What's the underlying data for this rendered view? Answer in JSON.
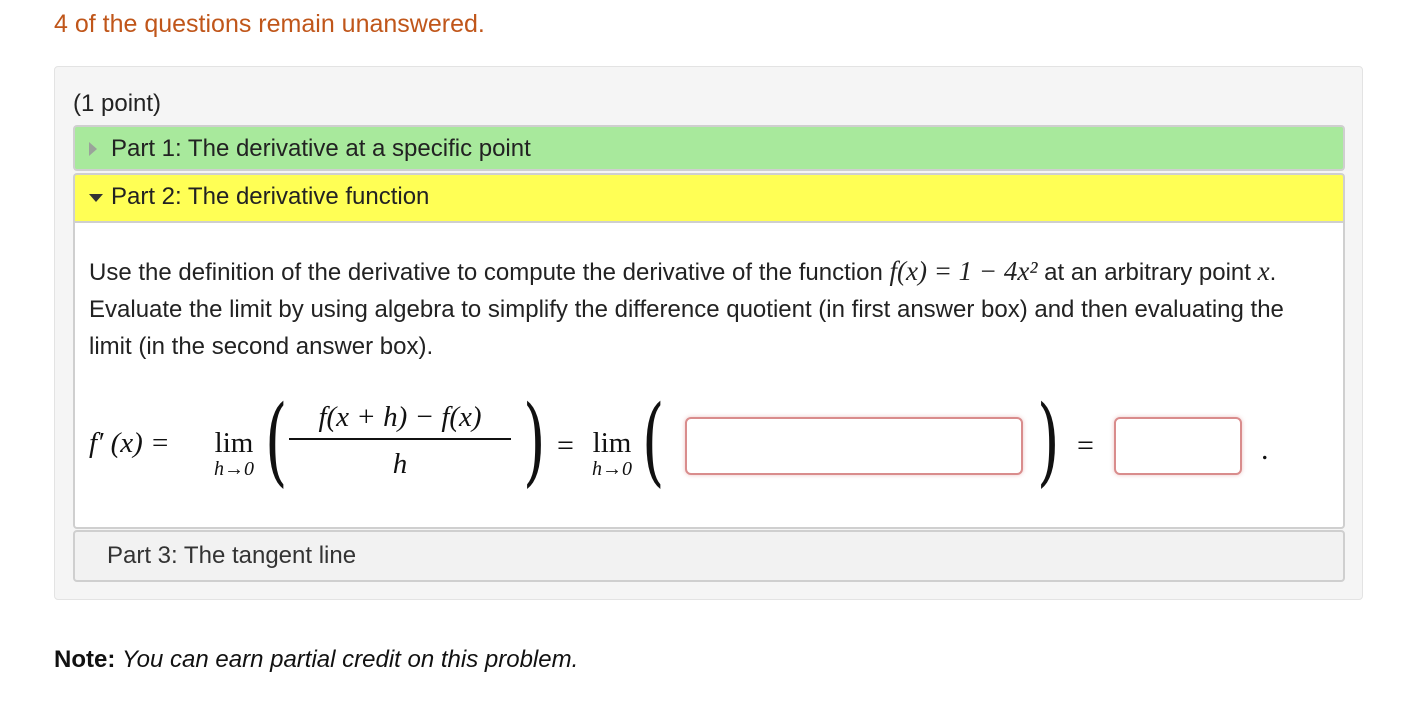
{
  "status": {
    "unanswered_text": "4 of the questions remain unanswered."
  },
  "problem": {
    "points_label": "(1 point)",
    "parts": [
      {
        "label": "Part 1: The derivative at a specific point",
        "state": "collapsed",
        "color": "#a8e99c"
      },
      {
        "label": "Part 2: The derivative function",
        "state": "expanded",
        "color": "#ffff55"
      },
      {
        "label": "Part 3: The tangent line",
        "state": "locked",
        "color": "#f2f2f2"
      }
    ],
    "question": {
      "text_1": "Use the definition of the derivative to compute the derivative of the function ",
      "function_expr": "f(x) = 1 − 4x²",
      "text_2": " at an arbitrary point ",
      "var": "x",
      "text_3": ". Evaluate the limit by using algebra to simplify the difference quotient (in first answer box) and then evaluating the limit (in the second answer box)."
    },
    "formula": {
      "lhs": "f′ (x) =",
      "lim": "lim",
      "lim_sub": "h→0",
      "numerator": "f(x + h) − f(x)",
      "denominator": "h",
      "equals": "=",
      "terminal": "."
    },
    "answer_1": {
      "value": "",
      "placeholder": ""
    },
    "answer_2": {
      "value": "",
      "placeholder": ""
    }
  },
  "note": {
    "label": "Note:",
    "text": "You can earn partial credit on this problem."
  }
}
